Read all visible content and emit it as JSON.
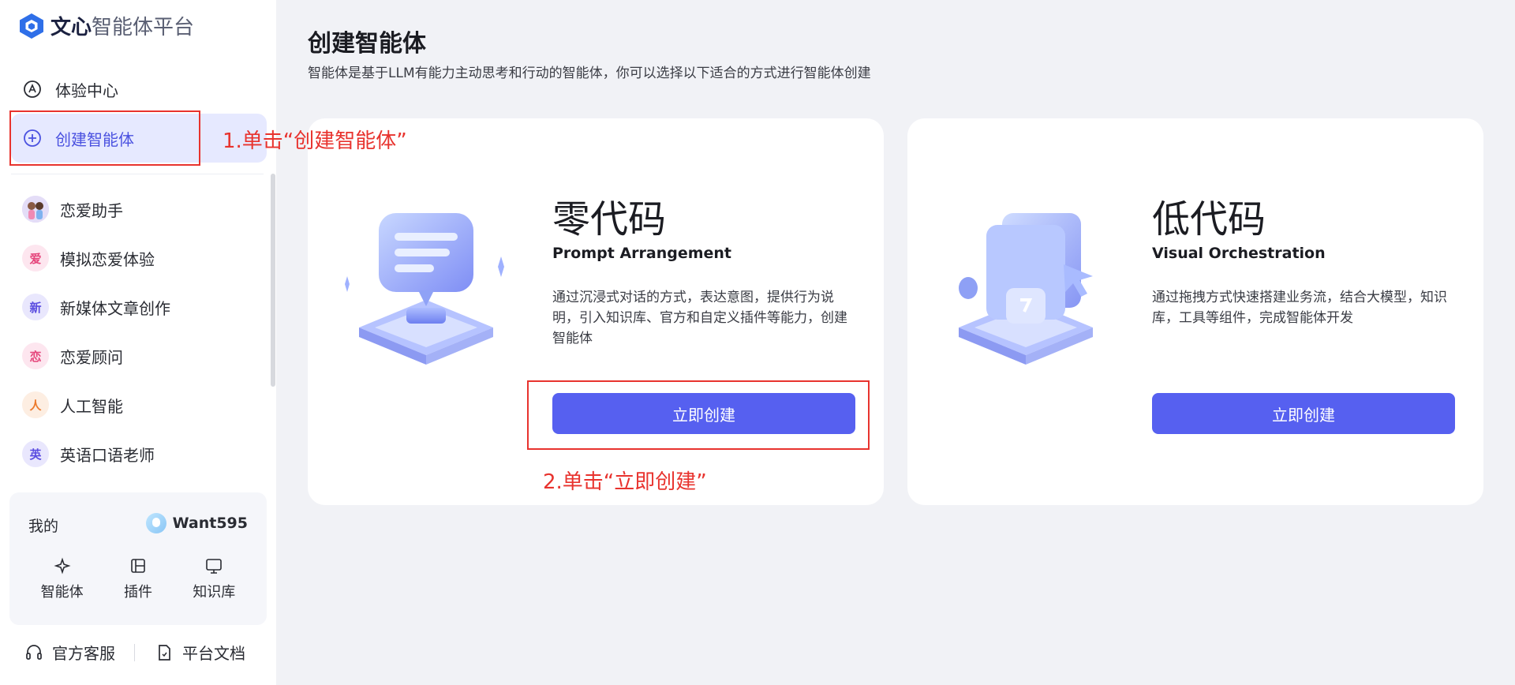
{
  "brand": {
    "name_bold": "文心",
    "name_rest": "智能体平台"
  },
  "nav": {
    "experience": "体验中心",
    "create": "创建智能体"
  },
  "agents": [
    {
      "avatar_char": "",
      "label": "恋爱助手",
      "avatar_bg": "#dcd6f5"
    },
    {
      "avatar_char": "爱",
      "label": "模拟恋爱体验",
      "avatar_bg": "#fde6ef",
      "avatar_color": "#e5457b"
    },
    {
      "avatar_char": "新",
      "label": "新媒体文章创作",
      "avatar_bg": "#e9e7fd",
      "avatar_color": "#5b4de0"
    },
    {
      "avatar_char": "恋",
      "label": "恋爱顾问",
      "avatar_bg": "#fde6ef",
      "avatar_color": "#e5457b"
    },
    {
      "avatar_char": "人",
      "label": "人工智能",
      "avatar_bg": "#fdeee2",
      "avatar_color": "#ec7a2c"
    },
    {
      "avatar_char": "英",
      "label": "英语口语老师",
      "avatar_bg": "#e9e7fd",
      "avatar_color": "#5b4de0"
    }
  ],
  "my": {
    "label": "我的",
    "username": "Want595",
    "tools": [
      "智能体",
      "插件",
      "知识库"
    ]
  },
  "footer": {
    "service": "官方客服",
    "docs": "平台文档"
  },
  "main": {
    "title": "创建智能体",
    "subtitle": "智能体是基于LLM有能力主动思考和行动的智能体，你可以选择以下适合的方式进行智能体创建"
  },
  "cards": [
    {
      "title": "零代码",
      "subtitle": "Prompt Arrangement",
      "desc": "通过沉浸式对话的方式，表达意图，提供行为说明，引入知识库、官方和自定义插件等能力，创建智能体",
      "button": "立即创建"
    },
    {
      "title": "低代码",
      "subtitle": "Visual Orchestration",
      "desc": "通过拖拽方式快速搭建业务流，结合大模型，知识库，工具等组件，完成智能体开发",
      "button": "立即创建"
    }
  ],
  "annotations": {
    "step1": "1.单击“创建智能体”",
    "step2": "2.单击“立即创建”"
  },
  "colors": {
    "accent": "#5660f0",
    "annotation": "#e8332e",
    "active_bg": "#e6e9ff"
  }
}
